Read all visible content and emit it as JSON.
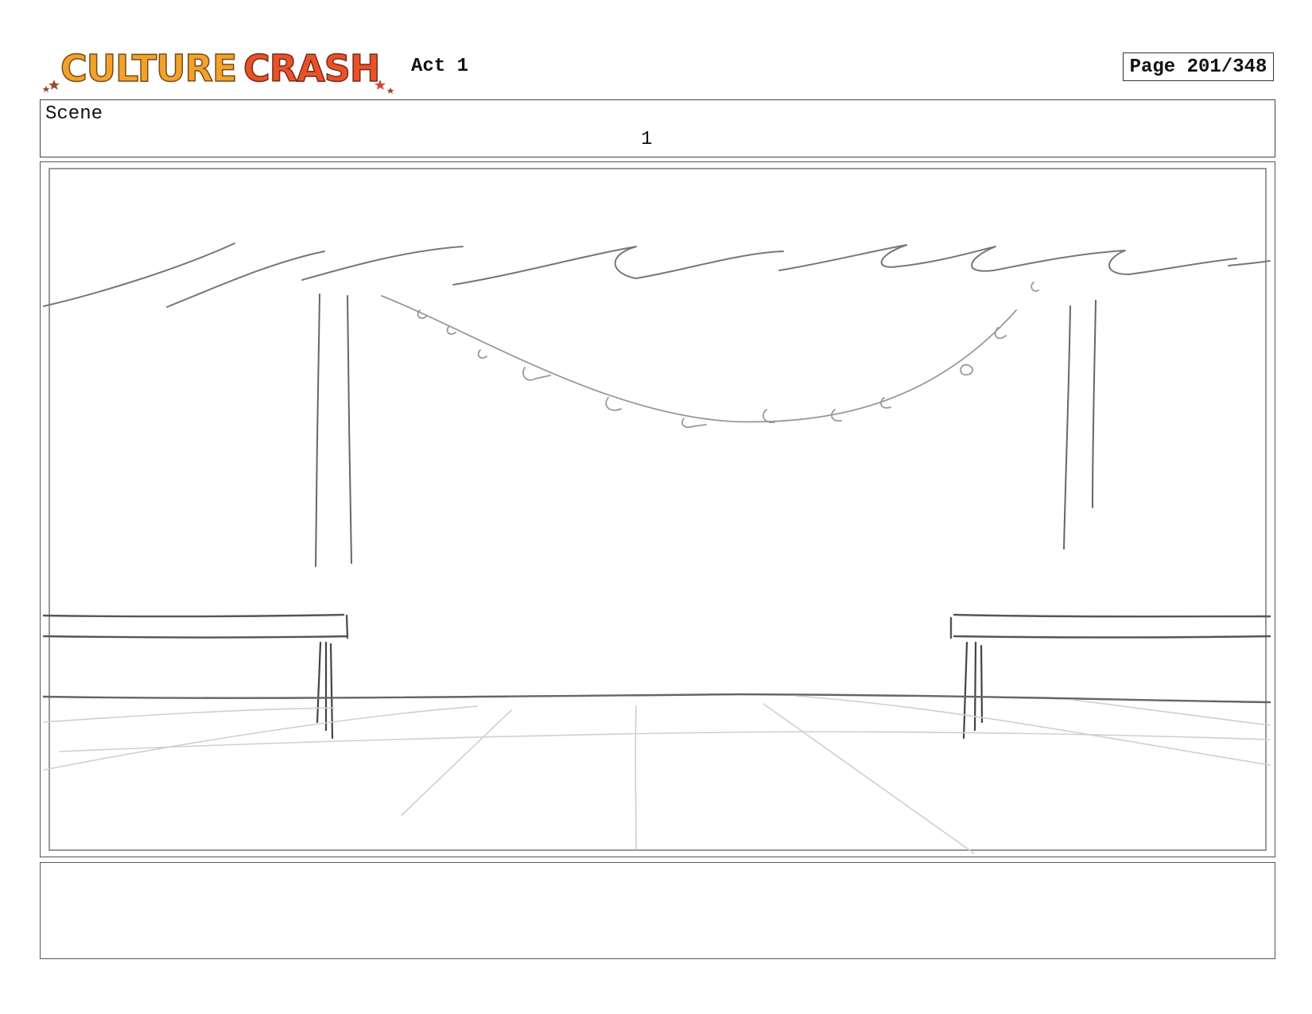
{
  "header": {
    "logo_text": "CULTURE CRASH",
    "act": "Act 1",
    "page": "Page 201/348"
  },
  "scene": {
    "label": "Scene",
    "number": "1"
  },
  "colors": {
    "logo_orange": "#F2A22C",
    "logo_red": "#E8522B",
    "star_brown": "#9C4A2E",
    "sketch_dark": "#555555",
    "sketch_light": "#BBBBBB"
  }
}
